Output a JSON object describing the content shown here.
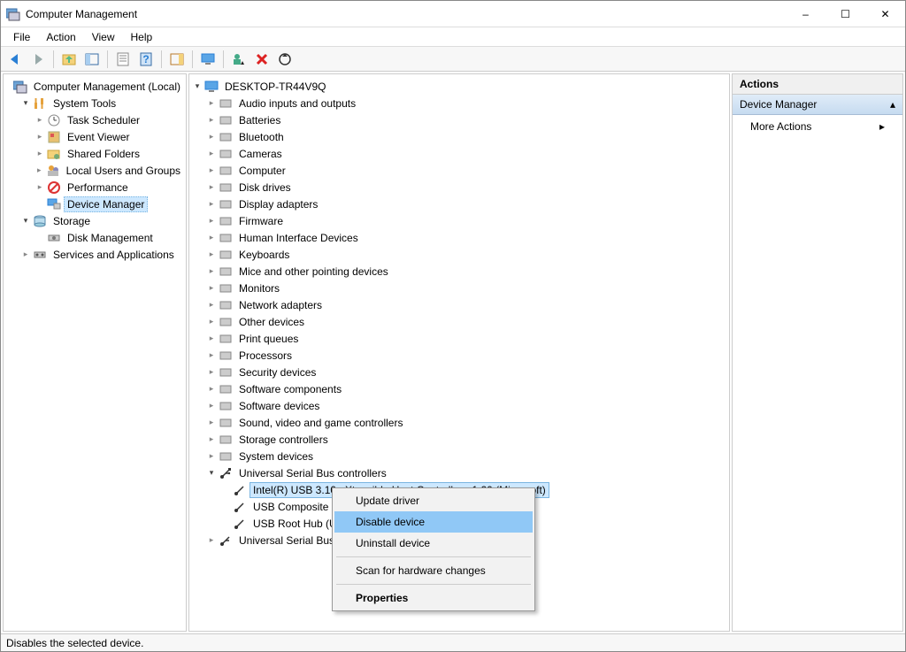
{
  "window": {
    "title": "Computer Management",
    "minimize": "–",
    "maximize": "☐",
    "close": "✕"
  },
  "menu": {
    "items": [
      "File",
      "Action",
      "View",
      "Help"
    ]
  },
  "toolbar": {
    "buttons": [
      "back",
      "forward",
      "sep",
      "up",
      "folders",
      "sep",
      "props",
      "help",
      "sep",
      "toggle",
      "sep",
      "monitor",
      "sep",
      "person",
      "delete",
      "refresh"
    ]
  },
  "left_tree": {
    "root": "Computer Management (Local)",
    "system_tools": "System Tools",
    "system_items": [
      "Task Scheduler",
      "Event Viewer",
      "Shared Folders",
      "Local Users and Groups",
      "Performance",
      "Device Manager"
    ],
    "storage": "Storage",
    "storage_items": [
      "Disk Management"
    ],
    "services": "Services and Applications"
  },
  "mid_tree": {
    "root": "DESKTOP-TR44V9Q",
    "cats": [
      "Audio inputs and outputs",
      "Batteries",
      "Bluetooth",
      "Cameras",
      "Computer",
      "Disk drives",
      "Display adapters",
      "Firmware",
      "Human Interface Devices",
      "Keyboards",
      "Mice and other pointing devices",
      "Monitors",
      "Network adapters",
      "Other devices",
      "Print queues",
      "Processors",
      "Security devices",
      "Software components",
      "Software devices",
      "Sound, video and game controllers",
      "Storage controllers",
      "System devices"
    ],
    "usb_label": "Universal Serial Bus controllers",
    "usb_children": [
      "Intel(R) USB 3.10 eXtensible Host Controller - 1.20 (Microsoft)",
      "USB Composite Device",
      "USB Root Hub (USB 3.0)"
    ],
    "usbd": "Universal Serial Bus devices"
  },
  "context_menu": {
    "items": [
      "Update driver",
      "Disable device",
      "Uninstall device",
      "Scan for hardware changes",
      "Properties"
    ],
    "hover_index": 1,
    "bold_index": 4
  },
  "actions": {
    "header": "Actions",
    "section": "Device Manager",
    "items": [
      "More Actions"
    ]
  },
  "statusbar": "Disables the selected device."
}
